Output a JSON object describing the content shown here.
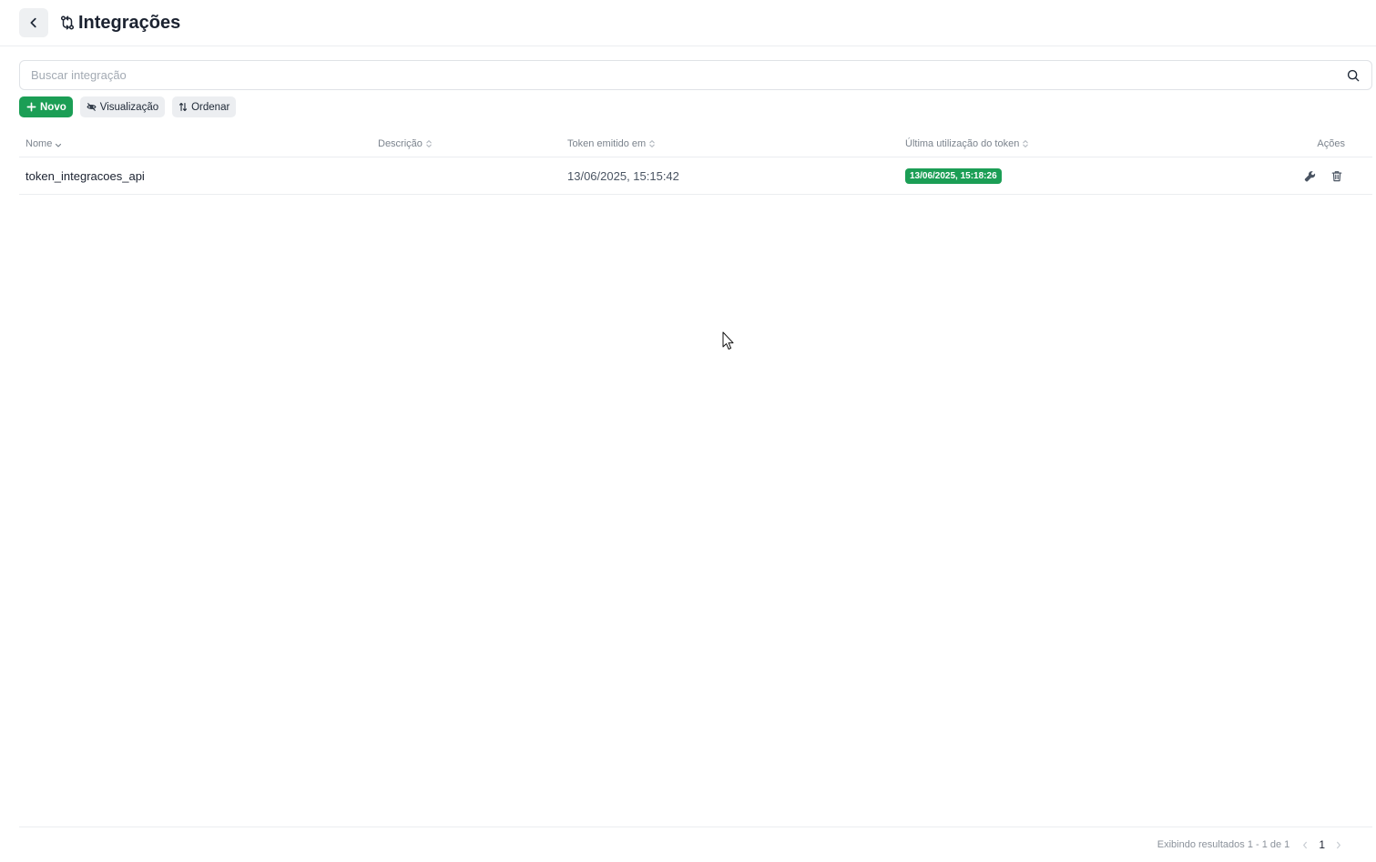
{
  "header": {
    "title": "Integrações",
    "back_icon": "chevron-left-icon",
    "title_icon": "git-compare-icon"
  },
  "search": {
    "placeholder": "Buscar integração",
    "value": "",
    "icon": "search-icon"
  },
  "toolbar": {
    "new_label": "Novo",
    "view_label": "Visualização",
    "sort_label": "Ordenar"
  },
  "table": {
    "columns": {
      "name": "Nome",
      "description": "Descrição",
      "issued": "Token emitido em",
      "last_used": "Última utilização do token",
      "actions": "Ações"
    },
    "rows": [
      {
        "name": "token_integracoes_api",
        "description": "",
        "issued": "13/06/2025, 15:15:42",
        "last_used": "13/06/2025, 15:18:26"
      }
    ]
  },
  "pagination": {
    "summary": "Exibindo resultados 1 - 1 de 1",
    "current_page": "1"
  },
  "colors": {
    "accent": "#1b9e55",
    "border": "#ebedf0",
    "muted_text": "#7b838d"
  }
}
